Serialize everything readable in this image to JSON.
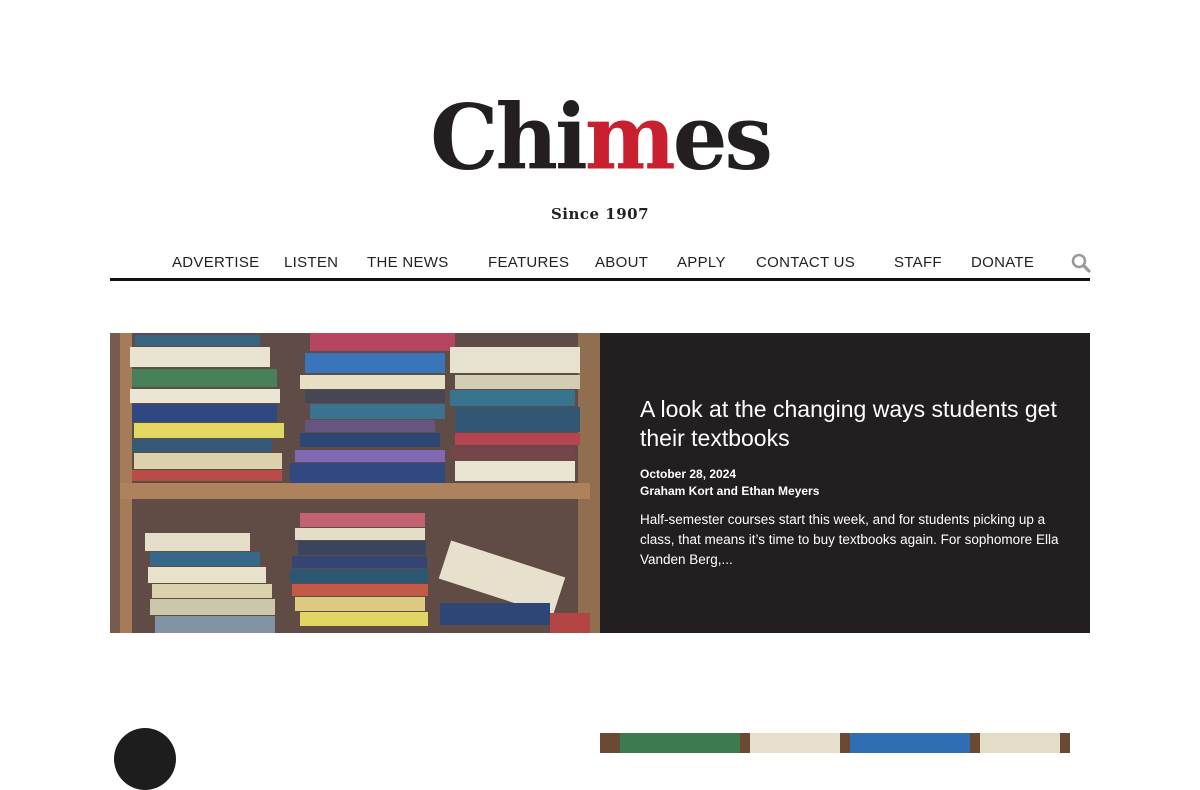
{
  "brand": {
    "logo_left": "Chi",
    "logo_accent": "m",
    "logo_right": "es",
    "tagline": "Since 1907",
    "accent_color": "#c8202f"
  },
  "nav": {
    "items": [
      "ADVERTISE",
      "LISTEN",
      "THE NEWS",
      "FEATURES",
      "ABOUT",
      "APPLY",
      "CONTACT US",
      "STAFF",
      "DONATE"
    ],
    "search_icon": "search-icon"
  },
  "featured": {
    "title": "A look at the changing ways students get their textbooks",
    "date": "October 28, 2024",
    "authors": "Graham Kort and Ethan Meyers",
    "excerpt": "Half-semester courses start this week, and for students picking up a class, that means it’s time to buy textbooks again. For sophomore Ella Vanden Berg,...",
    "image_alt": "Bookshelf with stacks of textbooks",
    "background": "#231f20"
  }
}
